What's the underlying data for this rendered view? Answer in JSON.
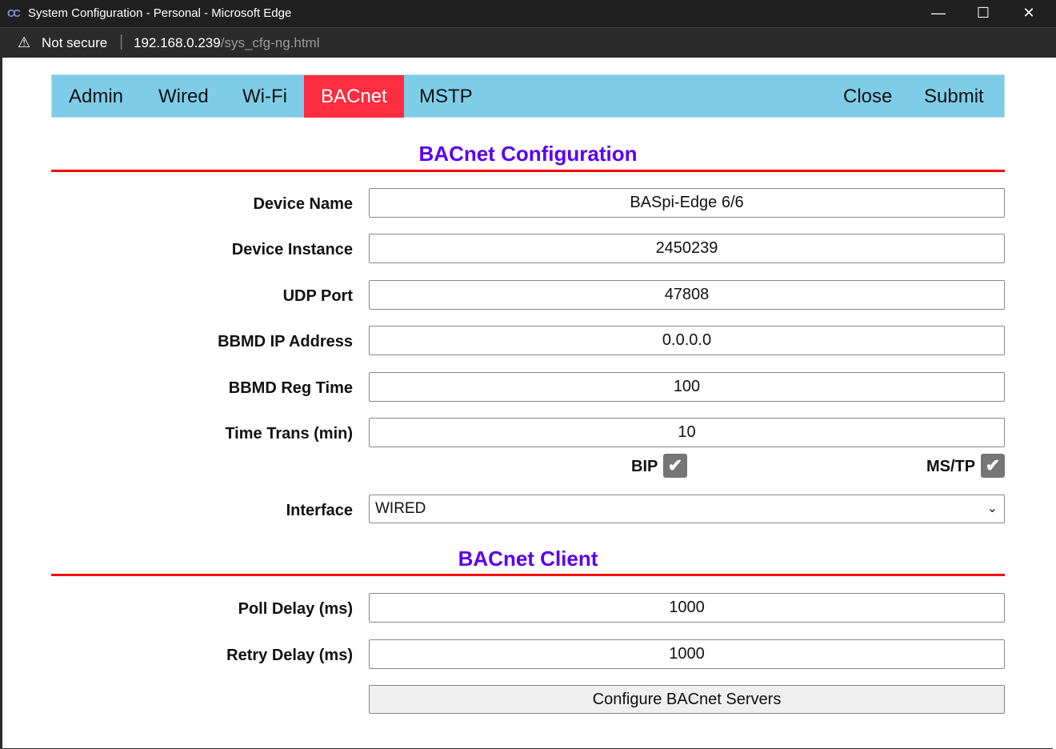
{
  "window": {
    "title": "System Configuration - Personal - Microsoft Edge",
    "minimize": "—",
    "maximize": "☐",
    "close": "✕"
  },
  "address": {
    "security": "Not secure",
    "host": "192.168.0.239",
    "path": "/sys_cfg-ng.html"
  },
  "nav": {
    "items": [
      "Admin",
      "Wired",
      "Wi-Fi",
      "BACnet",
      "MSTP"
    ],
    "active": "BACnet",
    "close": "Close",
    "submit": "Submit",
    "active_color": "#fe2d3f",
    "bar_color": "#7ecde8"
  },
  "config": {
    "title": "BACnet Configuration",
    "fields": [
      {
        "label": "Device Name",
        "value": "BASpi-Edge 6/6"
      },
      {
        "label": "Device Instance",
        "value": "2450239"
      },
      {
        "label": "UDP Port",
        "value": "47808"
      },
      {
        "label": "BBMD IP Address",
        "value": "0.0.0.0"
      },
      {
        "label": "BBMD Reg Time",
        "value": "100"
      },
      {
        "label": "Time Trans (min)",
        "value": "10"
      }
    ],
    "bip": {
      "label": "BIP",
      "checked": true
    },
    "mstp": {
      "label": "MS/TP",
      "checked": true
    },
    "interface": {
      "label": "Interface",
      "value": "WIRED"
    }
  },
  "client": {
    "title": "BACnet Client",
    "fields": [
      {
        "label": "Poll Delay (ms)",
        "value": "1000"
      },
      {
        "label": "Retry Delay (ms)",
        "value": "1000"
      }
    ],
    "configure_button": "Configure BACnet Servers"
  }
}
